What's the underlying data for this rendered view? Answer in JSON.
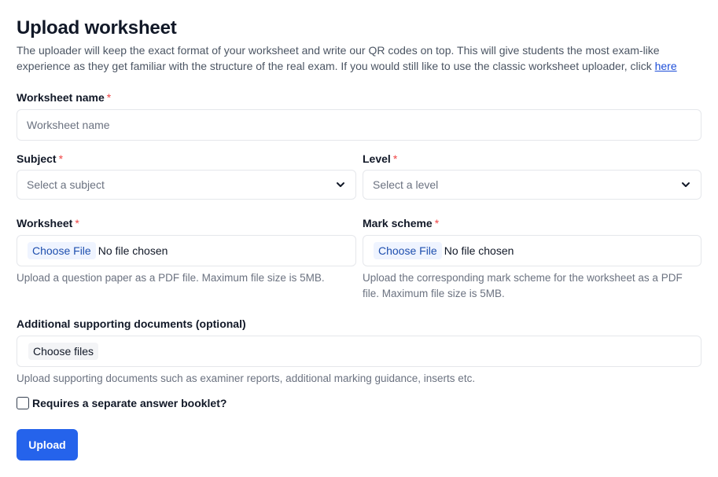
{
  "header": {
    "title": "Upload worksheet",
    "intro": "The uploader will keep the exact format of your worksheet and write our QR codes on top. This will give students the most exam-like experience as they get familiar with the structure of the real exam. If you would still like to use the classic worksheet uploader, click",
    "intro_link": "here"
  },
  "form": {
    "name": {
      "label": "Worksheet name",
      "required": "*",
      "placeholder": "Worksheet name"
    },
    "subject": {
      "label": "Subject",
      "required": "*",
      "placeholder": "Select a subject"
    },
    "level": {
      "label": "Level",
      "required": "*",
      "placeholder": "Select a level"
    },
    "worksheet": {
      "label": "Worksheet",
      "required": "*",
      "button": "Choose File",
      "status": "No file chosen",
      "help": "Upload a question paper as a PDF file. Maximum file size is 5MB."
    },
    "markscheme": {
      "label": "Mark scheme",
      "required": "*",
      "button": "Choose File",
      "status": "No file chosen",
      "help": "Upload the corresponding mark scheme for the worksheet as a PDF file. Maximum file size is 5MB."
    },
    "supporting": {
      "label": "Additional supporting documents (optional)",
      "button": "Choose files",
      "help": "Upload supporting documents such as examiner reports, additional marking guidance, inserts etc."
    },
    "booklet": {
      "label": "Requires a separate answer booklet?",
      "checked": false
    },
    "submit": "Upload"
  },
  "icons": {
    "select_chevron": "chevron-down-icon"
  },
  "colors": {
    "primary": "#2563eb",
    "required": "#ef4444",
    "link": "#1d4ed8"
  }
}
